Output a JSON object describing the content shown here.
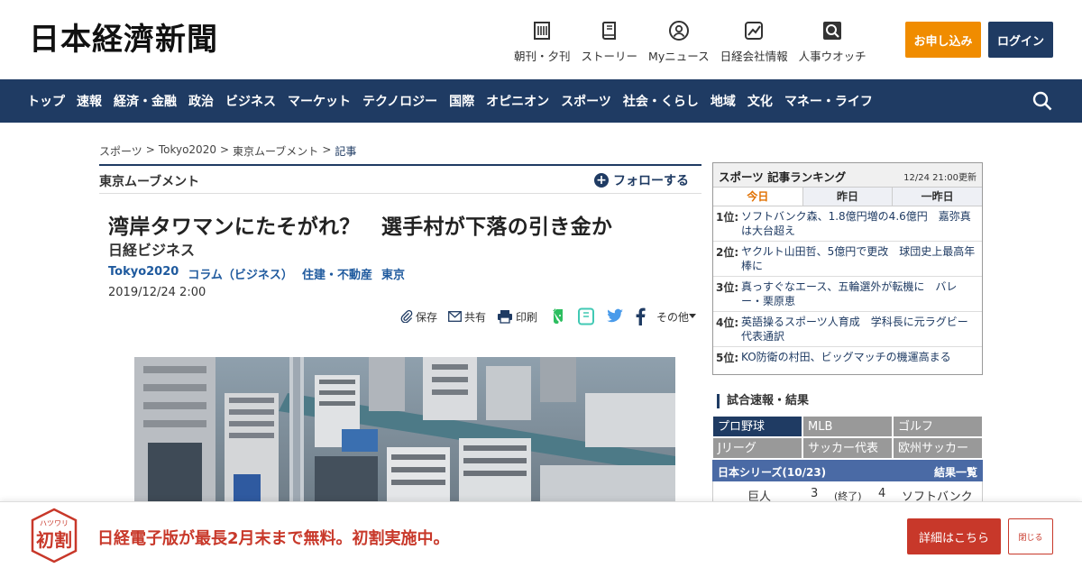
{
  "header": {
    "logo": "日本経濟新聞",
    "nav": [
      {
        "label": "朝刊・夕刊",
        "icon": "newspaper-icon"
      },
      {
        "label": "ストーリー",
        "icon": "book-icon"
      },
      {
        "label": "Myニュース",
        "icon": "user-icon"
      },
      {
        "label": "日経会社情報",
        "icon": "chart-icon"
      },
      {
        "label": "人事ウオッチ",
        "icon": "magnifier-icon"
      }
    ],
    "apply_label": "お申し込み",
    "login_label": "ログイン"
  },
  "global_nav": [
    "トップ",
    "速報",
    "経済・金融",
    "政治",
    "ビジネス",
    "マーケット",
    "テクノロジー",
    "国際",
    "オピニオン",
    "スポーツ",
    "社会・くらし",
    "地域",
    "文化",
    "マネー・ライフ"
  ],
  "breadcrumb": [
    "スポーツ",
    "Tokyo2020",
    "東京ムーブメント",
    "記事"
  ],
  "series": {
    "name": "東京ムーブメント",
    "follow_label": "フォローする"
  },
  "article": {
    "title": "湾岸タワマンにたそがれ？　選手村が下落の引き金か",
    "source": "日経ビジネス",
    "tags": [
      "Tokyo2020",
      "コラム（ビジネス）",
      "住建・不動産",
      "東京"
    ],
    "date": "2019/12/24 2:00",
    "actions": {
      "save": "保存",
      "share": "共有",
      "print": "印刷",
      "more": "その他"
    }
  },
  "ranking": {
    "title": "スポーツ 記事ランキング",
    "updated": "12/24 21:00更新",
    "tabs": [
      "今日",
      "昨日",
      "一昨日"
    ],
    "items": [
      {
        "rank": "1位:",
        "text": "ソフトバンク森、1.8億円増の4.6億円　嘉弥真は大台超え"
      },
      {
        "rank": "2位:",
        "text": "ヤクルト山田哲、5億円で更改　球団史上最高年棒に"
      },
      {
        "rank": "3位:",
        "text": "真っすぐなエース、五輪選外が転機に　バレー・栗原恵"
      },
      {
        "rank": "4位:",
        "text": "英語操るスポーツ人育成　学科長に元ラグビー代表通訳"
      },
      {
        "rank": "5位:",
        "text": "KO防衛の村田、ビッグマッチの機運高まる"
      }
    ]
  },
  "scores": {
    "title": "試合速報・結果",
    "categories": [
      [
        "プロ野球",
        "MLB",
        "ゴルフ"
      ],
      [
        "Jリーグ",
        "サッカー代表",
        "欧州サッカー"
      ]
    ],
    "series_title": "日本シリーズ(10/23)",
    "results_link": "結果一覧",
    "game": {
      "home": "巨人",
      "home_score": "3",
      "status": "(終了)",
      "away_score": "4",
      "away": "ソフトバンク"
    }
  },
  "banner": {
    "badge_top": "ハツワリ",
    "badge_main": "初割",
    "text": "日経電子版が最長2月末まで無料。初割実施中。",
    "detail_label": "詳細はこちら",
    "close_label": "閉じる"
  },
  "colors": {
    "navy": "#1f3b63",
    "orange": "#f08c00",
    "red": "#c8382a"
  }
}
